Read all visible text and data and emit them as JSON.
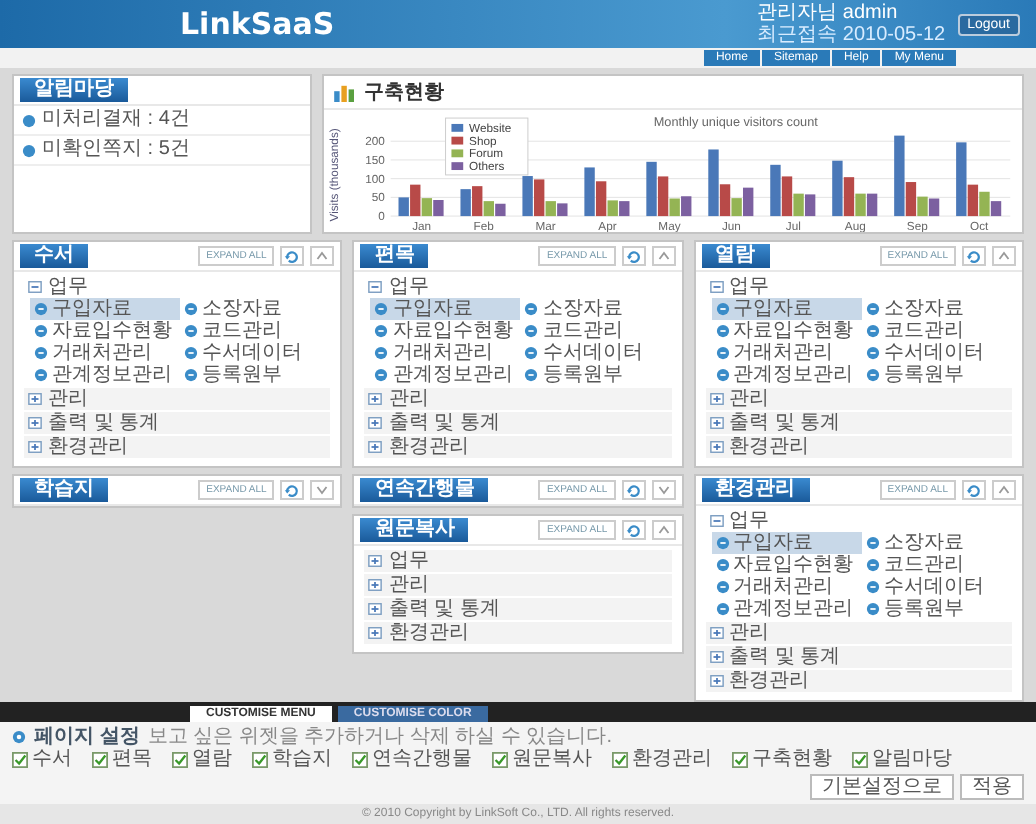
{
  "header": {
    "logo": "LinkSaaS",
    "user_line": "관리자님 admin",
    "info_line": "최근접속 2010-05-12",
    "logout": "Logout"
  },
  "nav": [
    "Home",
    "Sitemap",
    "Help",
    "My Menu"
  ],
  "alert_panel": {
    "title": "알림마당",
    "items": [
      "미처리결재 : 4건",
      "미확인쪽지 : 5건"
    ]
  },
  "chart_panel": {
    "title": "구축현황",
    "chart_data": {
      "type": "bar",
      "title": "Monthly unique visitors count",
      "ylabel": "Visits (thousands)",
      "categories": [
        "Jan",
        "Feb",
        "Mar",
        "Apr",
        "May",
        "Jun",
        "Jul",
        "Aug",
        "Sep",
        "Oct"
      ],
      "series": [
        {
          "name": "Website",
          "color": "#4a78b8",
          "values": [
            50,
            72,
            107,
            130,
            145,
            178,
            137,
            148,
            215,
            197
          ]
        },
        {
          "name": "Shop",
          "color": "#b84a48",
          "values": [
            84,
            80,
            98,
            93,
            106,
            85,
            106,
            104,
            91,
            84
          ]
        },
        {
          "name": "Forum",
          "color": "#94b454",
          "values": [
            48,
            40,
            40,
            42,
            47,
            48,
            60,
            60,
            52,
            65
          ]
        },
        {
          "name": "Others",
          "color": "#7c60a0",
          "values": [
            43,
            33,
            34,
            40,
            53,
            76,
            58,
            60,
            47,
            40
          ]
        }
      ],
      "ylim": [
        0,
        220
      ],
      "yticks": [
        0,
        50,
        100,
        150,
        200
      ],
      "grid": true,
      "legend": true
    }
  },
  "columns": [
    {
      "widgets": [
        {
          "title": "수서",
          "expand_label": "EXPAND ALL",
          "expanded": true,
          "groups": [
            {
              "label": "업무",
              "expanded": true,
              "children": [
                {
                  "label": "구입자료",
                  "selected": true
                },
                {
                  "label": "소장자료",
                  "selected": false
                },
                {
                  "label": "자료입수현황",
                  "selected": false
                },
                {
                  "label": "코드관리",
                  "selected": false
                },
                {
                  "label": "거래처관리",
                  "selected": false
                },
                {
                  "label": "수서데이터",
                  "selected": false
                },
                {
                  "label": "관계정보관리",
                  "selected": false
                },
                {
                  "label": "등록원부",
                  "selected": false
                }
              ]
            },
            {
              "label": "관리",
              "expanded": false
            },
            {
              "label": "출력 및 통계",
              "expanded": false
            },
            {
              "label": "환경관리",
              "expanded": false
            }
          ]
        },
        {
          "title": "학습지",
          "expand_label": "EXPAND ALL",
          "expanded": false
        }
      ]
    },
    {
      "widgets": [
        {
          "title": "편목",
          "expand_label": "EXPAND ALL",
          "expanded": true,
          "groups": [
            {
              "label": "업무",
              "expanded": true,
              "children": [
                {
                  "label": "구입자료",
                  "selected": true
                },
                {
                  "label": "소장자료",
                  "selected": false
                },
                {
                  "label": "자료입수현황",
                  "selected": false
                },
                {
                  "label": "코드관리",
                  "selected": false
                },
                {
                  "label": "거래처관리",
                  "selected": false
                },
                {
                  "label": "수서데이터",
                  "selected": false
                },
                {
                  "label": "관계정보관리",
                  "selected": false
                },
                {
                  "label": "등록원부",
                  "selected": false
                }
              ]
            },
            {
              "label": "관리",
              "expanded": false
            },
            {
              "label": "출력 및 통계",
              "expanded": false
            },
            {
              "label": "환경관리",
              "expanded": false
            }
          ]
        },
        {
          "title": "연속간행물",
          "expand_label": "EXPAND ALL",
          "expanded": false
        },
        {
          "title": "원문복사",
          "expand_label": "EXPAND ALL",
          "expanded": true,
          "groups": [
            {
              "label": "업무",
              "expanded": false
            },
            {
              "label": "관리",
              "expanded": false
            },
            {
              "label": "출력 및 통계",
              "expanded": false
            },
            {
              "label": "환경관리",
              "expanded": false
            }
          ]
        }
      ]
    },
    {
      "widgets": [
        {
          "title": "열람",
          "expand_label": "EXPAND ALL",
          "expanded": true,
          "groups": [
            {
              "label": "업무",
              "expanded": true,
              "children": [
                {
                  "label": "구입자료",
                  "selected": true
                },
                {
                  "label": "소장자료",
                  "selected": false
                },
                {
                  "label": "자료입수현황",
                  "selected": false
                },
                {
                  "label": "코드관리",
                  "selected": false
                },
                {
                  "label": "거래처관리",
                  "selected": false
                },
                {
                  "label": "수서데이터",
                  "selected": false
                },
                {
                  "label": "관계정보관리",
                  "selected": false
                },
                {
                  "label": "등록원부",
                  "selected": false
                }
              ]
            },
            {
              "label": "관리",
              "expanded": false
            },
            {
              "label": "출력 및 통계",
              "expanded": false
            },
            {
              "label": "환경관리",
              "expanded": false
            }
          ]
        },
        {
          "title": "환경관리",
          "expand_label": "EXPAND ALL",
          "expanded": true,
          "groups": [
            {
              "label": "업무",
              "expanded": true,
              "children": [
                {
                  "label": "구입자료",
                  "selected": true
                },
                {
                  "label": "소장자료",
                  "selected": false
                },
                {
                  "label": "자료입수현황",
                  "selected": false
                },
                {
                  "label": "코드관리",
                  "selected": false
                },
                {
                  "label": "거래처관리",
                  "selected": false
                },
                {
                  "label": "수서데이터",
                  "selected": false
                },
                {
                  "label": "관계정보관리",
                  "selected": false
                },
                {
                  "label": "등록원부",
                  "selected": false
                }
              ]
            },
            {
              "label": "관리",
              "expanded": false
            },
            {
              "label": "출력 및 통계",
              "expanded": false
            },
            {
              "label": "환경관리",
              "expanded": false
            }
          ]
        }
      ]
    }
  ],
  "customise": {
    "tabs": [
      {
        "label": "CUSTOMISE MENU",
        "selected": true
      },
      {
        "label": "CUSTOMISE COLOR",
        "selected": false
      }
    ],
    "heading": "페이지 설정",
    "description": "보고 싶은 위젯을 추가하거나 삭제 하실 수 있습니다.",
    "options": [
      {
        "label": "수서",
        "checked": true
      },
      {
        "label": "편목",
        "checked": true
      },
      {
        "label": "열람",
        "checked": true
      },
      {
        "label": "학습지",
        "checked": true
      },
      {
        "label": "연속간행물",
        "checked": true
      },
      {
        "label": "원문복사",
        "checked": true
      },
      {
        "label": "환경관리",
        "checked": true
      },
      {
        "label": "구축현황",
        "checked": true
      },
      {
        "label": "알림마당",
        "checked": true
      }
    ],
    "buttons": [
      "기본설정으로",
      "적용"
    ]
  },
  "footer": "© 2010 Copyright by LinkSoft Co., LTD. All rights reserved."
}
